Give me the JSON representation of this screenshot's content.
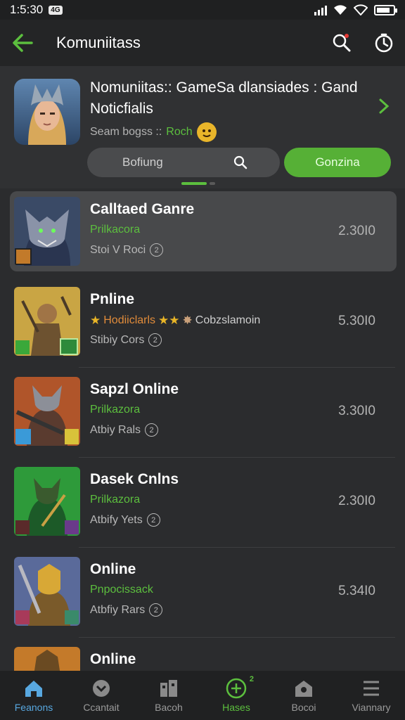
{
  "status_bar": {
    "time": "1:5:30",
    "chip": "4G",
    "battery_level": 0.8
  },
  "app_bar": {
    "title": "Komuniitass"
  },
  "header": {
    "title": "Nomuniitas:: GameSa dlansiades : Gand Noticfialis",
    "sub_text": "Seam bogss ::",
    "sub_accent": "Roch",
    "segment_left_label": "Bofiung",
    "segment_right_label": "Gonzina"
  },
  "rows": [
    {
      "title": "Calltaed Ganre",
      "subtitle": "Prilkacora",
      "meta": "Stoi V Roci",
      "value": "2.30I0",
      "selected": true
    },
    {
      "title": "Pnline",
      "subtitle": "Hodiiclarls",
      "subtitle_extra": "Cobzslamoin",
      "meta": "Stibiy Cors",
      "value": "5.30I0"
    },
    {
      "title": "Sapzl Online",
      "subtitle": "Prilkazora",
      "meta": "Atbiy Rals",
      "value": "3.30I0"
    },
    {
      "title": "Dasek Cnlns",
      "subtitle": "Prilkazora",
      "meta": "Atbify Yets",
      "value": "2.30I0"
    },
    {
      "title": "Online",
      "subtitle": "Pnpocissack",
      "meta": "Atbfiy Rars",
      "value": "5.34I0"
    },
    {
      "title": "Online"
    }
  ],
  "bottom_nav": [
    {
      "label": "Feanons",
      "icon": "home-icon"
    },
    {
      "label": "Ccantait",
      "icon": "chat-icon"
    },
    {
      "label": "Bacoh",
      "icon": "library-icon"
    },
    {
      "label": "Hases",
      "icon": "add-circle-icon",
      "badge": "2"
    },
    {
      "label": "Bocoi",
      "icon": "store-icon"
    },
    {
      "label": "Viannary",
      "icon": "menu-icon"
    }
  ],
  "colors": {
    "accent": "#5cbf3e",
    "active_nav": "#58a8e0",
    "background": "#2b2c2e"
  }
}
